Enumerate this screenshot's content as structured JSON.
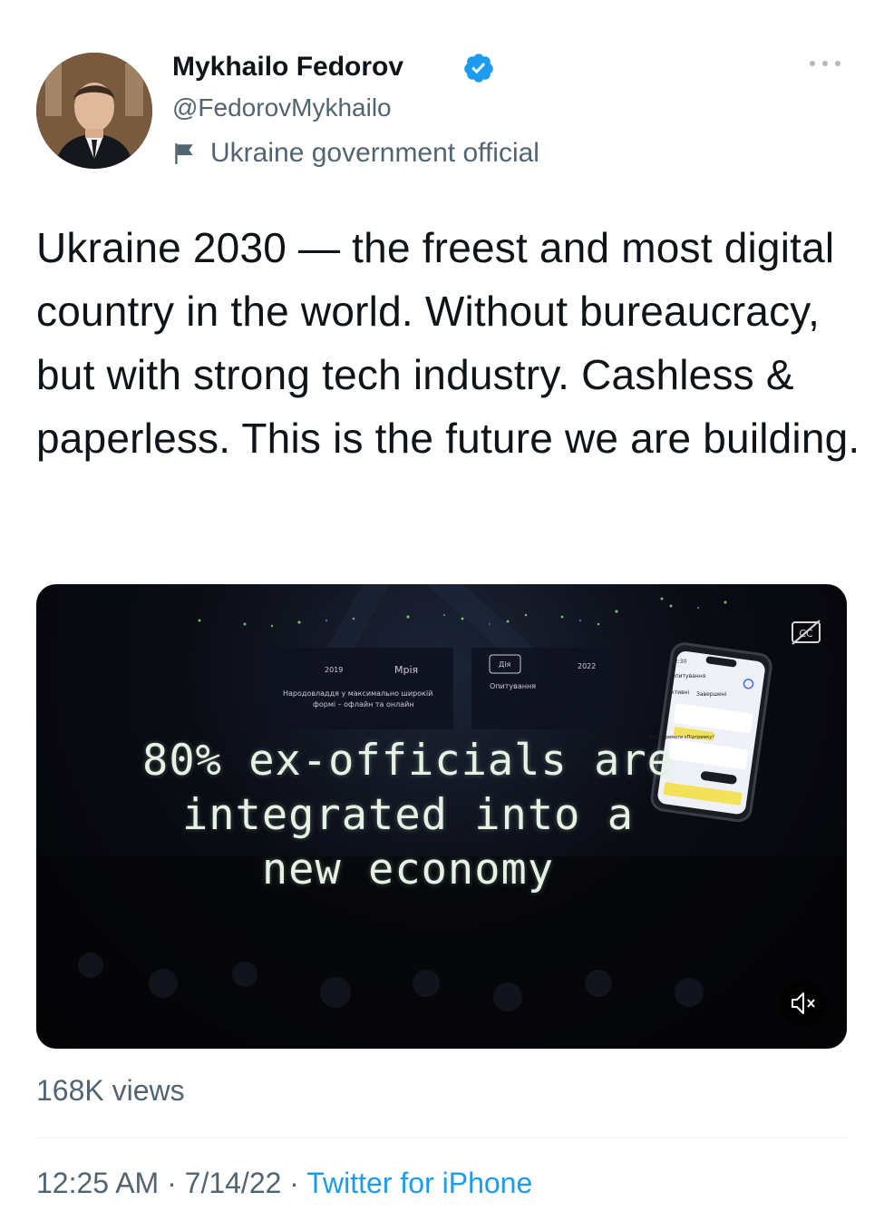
{
  "user": {
    "display_name": "Mykhailo Fedorov",
    "handle": "@FedorovMykhailo",
    "label": "Ukraine government official",
    "verified_color": "#1d9bf0"
  },
  "tweet": {
    "text": "Ukraine 2030 — the freest and most digital country in the world. Without bureaucracy, but with strong tech industry. Cashless & paperless. This is the future we are building."
  },
  "media": {
    "caption_lines": [
      "80% ex-officials are",
      "integrated into a",
      "new economy"
    ],
    "stage": {
      "year_left": "2019",
      "title": "Мрія",
      "subtitle_line1": "Народовладдя у максимально широкій",
      "subtitle_line2": "формі – офлайн та онлайн",
      "app_badge": "Дія",
      "app_caption": "Опитування",
      "year_right": "2022"
    },
    "phone": {
      "time": "12:30",
      "header": "Опитування",
      "tab_active": "Активні",
      "tab_done": "Завершені",
      "question": "Вам отримати єПідтримку?"
    },
    "controls": {
      "cc": "CC"
    }
  },
  "stats": {
    "views": "168K views"
  },
  "meta": {
    "time": "12:25 AM",
    "sep": "·",
    "date": "7/14/22",
    "source": "Twitter for iPhone",
    "source_color": "#1d9bf0"
  }
}
